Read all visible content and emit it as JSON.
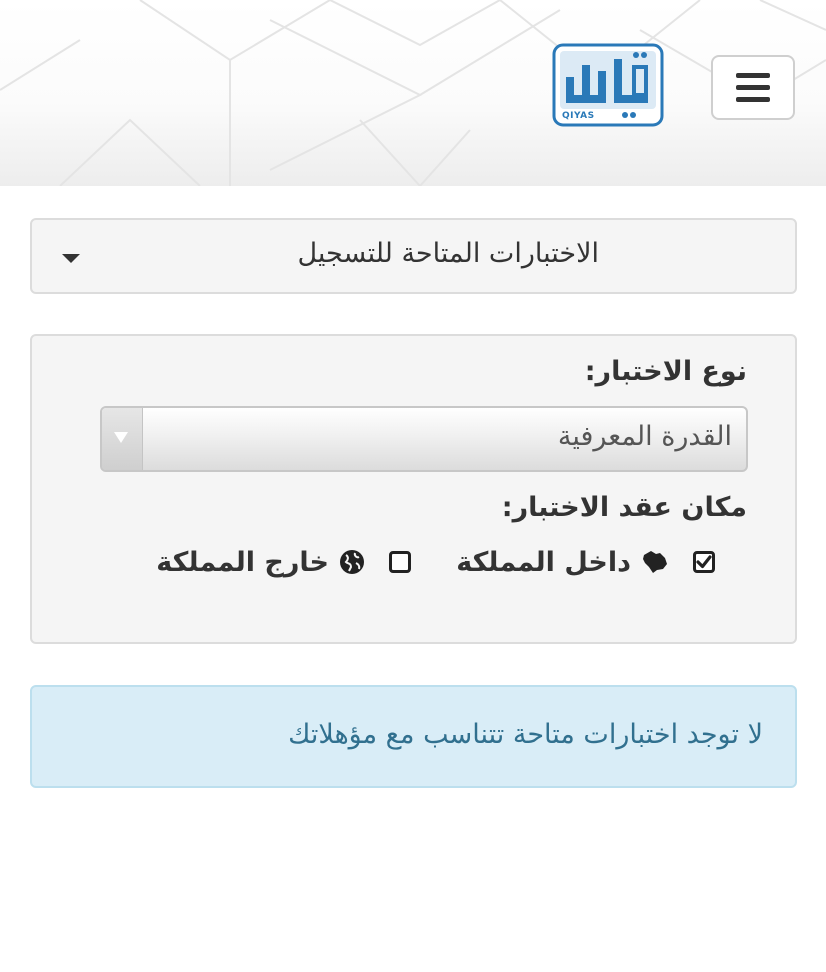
{
  "header": {
    "menu_label": "menu",
    "logo_caption": "QIYAS",
    "brand_color": "#2a79b8"
  },
  "exams_dropdown": {
    "title": "الاختبارات المتاحة للتسجيل"
  },
  "filters": {
    "exam_type_label": "نوع الاختبار:",
    "exam_type_value": "القدرة المعرفية",
    "location_label": "مكان عقد الاختبار:",
    "locations": [
      {
        "label": "داخل المملكة",
        "checked": true,
        "icon": "saudi-map-icon"
      },
      {
        "label": "خارج المملكة",
        "checked": false,
        "icon": "globe-icon"
      }
    ]
  },
  "alert": {
    "message": "لا توجد اختبارات متاحة تتناسب مع مؤهلاتك",
    "background": "#d9edf7",
    "text_color": "#31708f"
  }
}
